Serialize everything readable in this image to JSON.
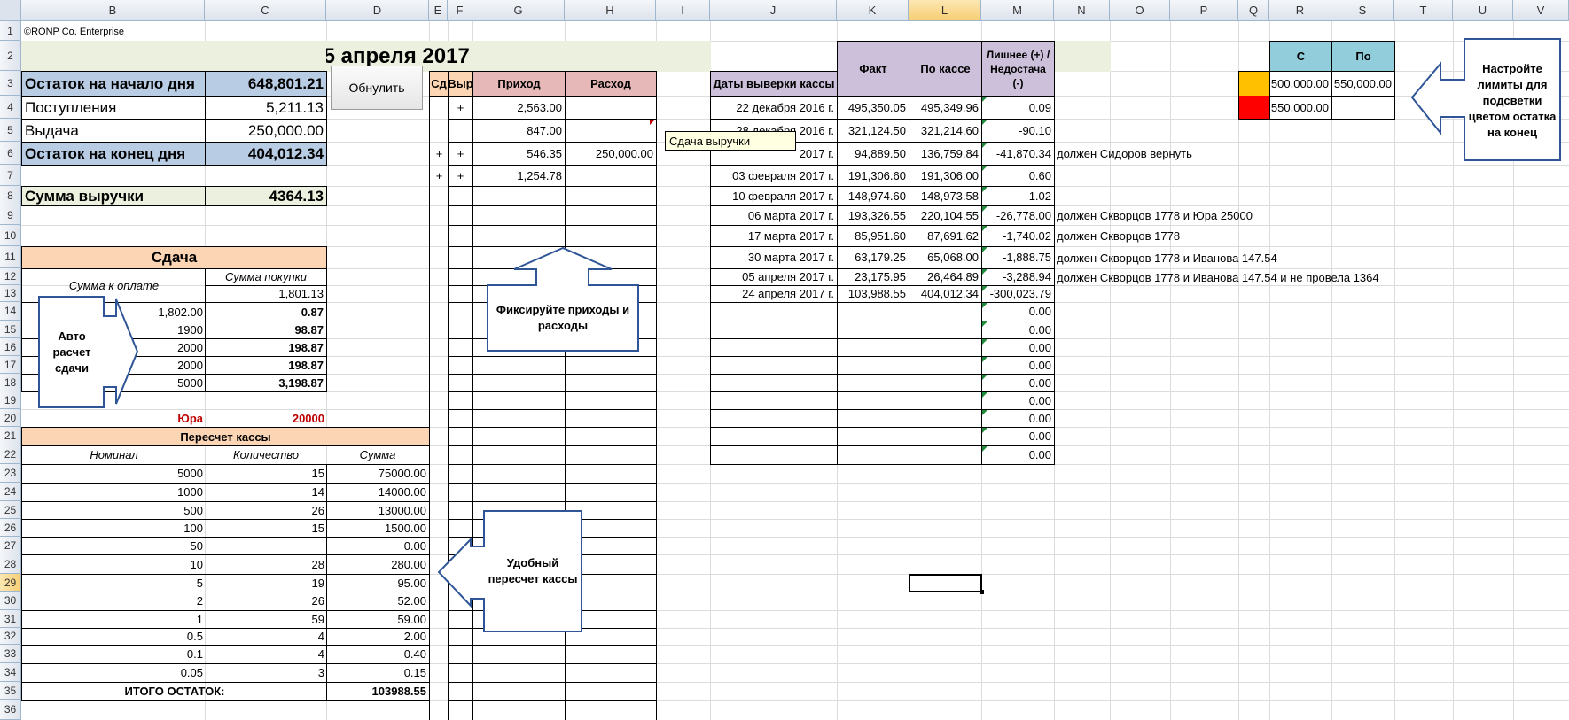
{
  "colors": {
    "light_green": "#ebf1de",
    "blue": "#b8cce4",
    "peach": "#fcd5b4",
    "pink": "#e6b8b7",
    "lavender": "#ccc0da",
    "sky": "#92cddc",
    "orange_swatch": "#ffc000",
    "red_swatch": "#ff0000",
    "red_text": "#c00000",
    "shape_border": "#2f5597"
  },
  "columns": [
    "",
    "B",
    "C",
    "D",
    "E",
    "F",
    "G",
    "H",
    "I",
    "J",
    "K",
    "L",
    "M",
    "N",
    "O",
    "P",
    "Q",
    "R",
    "S",
    "T",
    "U",
    "V"
  ],
  "rows": [
    "1",
    "2",
    "3",
    "4",
    "5",
    "6",
    "7",
    "8",
    "9",
    "10",
    "11",
    "12",
    "13",
    "14",
    "15",
    "16",
    "17",
    "18",
    "19",
    "20",
    "21",
    "22",
    "23",
    "24",
    "25",
    "26",
    "27",
    "28",
    "29",
    "30",
    "31",
    "32",
    "33",
    "34",
    "35",
    "36"
  ],
  "copyright": "©RONP Co. Enterprise",
  "date_title": "25 апреля 2017 г.",
  "reset_button": "Обнулить",
  "summary": [
    {
      "label": "Остаток на начало дня",
      "value": "648,801.21"
    },
    {
      "label": "Поступления",
      "value": "5,211.13"
    },
    {
      "label": "Выдача",
      "value": "250,000.00"
    },
    {
      "label": "Остаток на конец дня",
      "value": "404,012.34"
    }
  ],
  "revenue": {
    "label": "Сумма выручки",
    "value": "4364.13"
  },
  "change": {
    "title": "Сдача",
    "col_to_pay": "Сумма к оплате",
    "col_purchase": "Сумма покупки",
    "purchase_value": "1,801.13",
    "rows": [
      {
        "pay": "1,802.00",
        "change": "0.87"
      },
      {
        "pay": "1900",
        "change": "98.87"
      },
      {
        "pay": "2000",
        "change": "198.87"
      },
      {
        "pay": "2000",
        "change": "198.87"
      },
      {
        "pay": "5000",
        "change": "3,198.87"
      }
    ]
  },
  "yura": {
    "name": "Юра",
    "amount": "20000"
  },
  "recount": {
    "title": "Пересчет кассы",
    "headers": [
      "Номинал",
      "Количество",
      "Сумма"
    ],
    "rows": [
      [
        "5000",
        "15",
        "75000.00"
      ],
      [
        "1000",
        "14",
        "14000.00"
      ],
      [
        "500",
        "26",
        "13000.00"
      ],
      [
        "100",
        "15",
        "1500.00"
      ],
      [
        "50",
        "",
        "0.00"
      ],
      [
        "10",
        "28",
        "280.00"
      ],
      [
        "5",
        "19",
        "95.00"
      ],
      [
        "2",
        "26",
        "52.00"
      ],
      [
        "1",
        "59",
        "59.00"
      ],
      [
        "0.5",
        "4",
        "2.00"
      ],
      [
        "0.1",
        "4",
        "0.40"
      ],
      [
        "0.05",
        "3",
        "0.15"
      ]
    ],
    "total_label": "ИТОГО ОСТАТОК:",
    "total_value": "103988.55"
  },
  "ledger": {
    "headers": [
      "Сд",
      "Выр",
      "Приход",
      "Расход"
    ],
    "rows": [
      {
        "e": "",
        "f": "+",
        "in": "2,563.00",
        "out": ""
      },
      {
        "e": "",
        "f": "",
        "in": "847.00",
        "out": ""
      },
      {
        "e": "+",
        "f": "+",
        "in": "546.35",
        "out": "250,000.00"
      },
      {
        "e": "+",
        "f": "+",
        "in": "1,254.78",
        "out": ""
      }
    ]
  },
  "comment_note": "Сдача выручки",
  "audit": {
    "header_dates": "Даты выверки кассы",
    "header_fact": "Факт",
    "header_cash": "По кассе",
    "header_diff": "Лишнее (+) /Недостача (-)",
    "rows": [
      {
        "date": "22 декабря 2016 г.",
        "fact": "495,350.05",
        "cash": "495,349.96",
        "diff": "0.09",
        "note": ""
      },
      {
        "date": "28 декабря 2016 г.",
        "fact": "321,124.50",
        "cash": "321,214.60",
        "diff": "-90.10",
        "note": ""
      },
      {
        "date": "2017 г.",
        "fact": "94,889.50",
        "cash": "136,759.84",
        "diff": "-41,870.34",
        "note": "должен Сидоров вернуть"
      },
      {
        "date": "03 февраля 2017 г.",
        "fact": "191,306.60",
        "cash": "191,306.00",
        "diff": "0.60",
        "note": ""
      },
      {
        "date": "10 февраля 2017 г.",
        "fact": "148,974.60",
        "cash": "148,973.58",
        "diff": "1.02",
        "note": ""
      },
      {
        "date": "06 марта 2017 г.",
        "fact": "193,326.55",
        "cash": "220,104.55",
        "diff": "-26,778.00",
        "note": "должен Скворцов 1778 и Юра 25000"
      },
      {
        "date": "17 марта 2017 г.",
        "fact": "85,951.60",
        "cash": "87,691.62",
        "diff": "-1,740.02",
        "note": "должен Скворцов 1778"
      },
      {
        "date": "30 марта 2017 г.",
        "fact": "63,179.25",
        "cash": "65,068.00",
        "diff": "-1,888.75",
        "note": "должен Скворцов 1778 и Иванова 147.54"
      },
      {
        "date": "05 апреля 2017 г.",
        "fact": "23,175.95",
        "cash": "26,464.89",
        "diff": "-3,288.94",
        "note": "должен Скворцов 1778 и Иванова 147.54 и не провела 1364"
      },
      {
        "date": "24 апреля 2017 г.",
        "fact": "103,988.55",
        "cash": "404,012.34",
        "diff": "-300,023.79",
        "note": ""
      },
      {
        "date": "",
        "fact": "",
        "cash": "",
        "diff": "0.00",
        "note": ""
      },
      {
        "date": "",
        "fact": "",
        "cash": "",
        "diff": "0.00",
        "note": ""
      },
      {
        "date": "",
        "fact": "",
        "cash": "",
        "diff": "0.00",
        "note": ""
      },
      {
        "date": "",
        "fact": "",
        "cash": "",
        "diff": "0.00",
        "note": ""
      },
      {
        "date": "",
        "fact": "",
        "cash": "",
        "diff": "0.00",
        "note": ""
      },
      {
        "date": "",
        "fact": "",
        "cash": "",
        "diff": "0.00",
        "note": ""
      },
      {
        "date": "",
        "fact": "",
        "cash": "",
        "diff": "0.00",
        "note": ""
      },
      {
        "date": "",
        "fact": "",
        "cash": "",
        "diff": "0.00",
        "note": ""
      },
      {
        "date": "",
        "fact": "",
        "cash": "",
        "diff": "0.00",
        "note": ""
      }
    ]
  },
  "limits": {
    "header_from": "С",
    "header_to": "По",
    "rows": [
      {
        "from": "500,000.00",
        "to": "550,000.00"
      },
      {
        "from": "550,000.00",
        "to": ""
      }
    ]
  },
  "callouts": {
    "limits": "Настройте лимиты для подсветки цветом остатка на конец",
    "ledger": "Фиксируйте  приходы и расходы",
    "change": "Авто расчет сдачи",
    "recount": "Удобный пересчет кассы"
  }
}
